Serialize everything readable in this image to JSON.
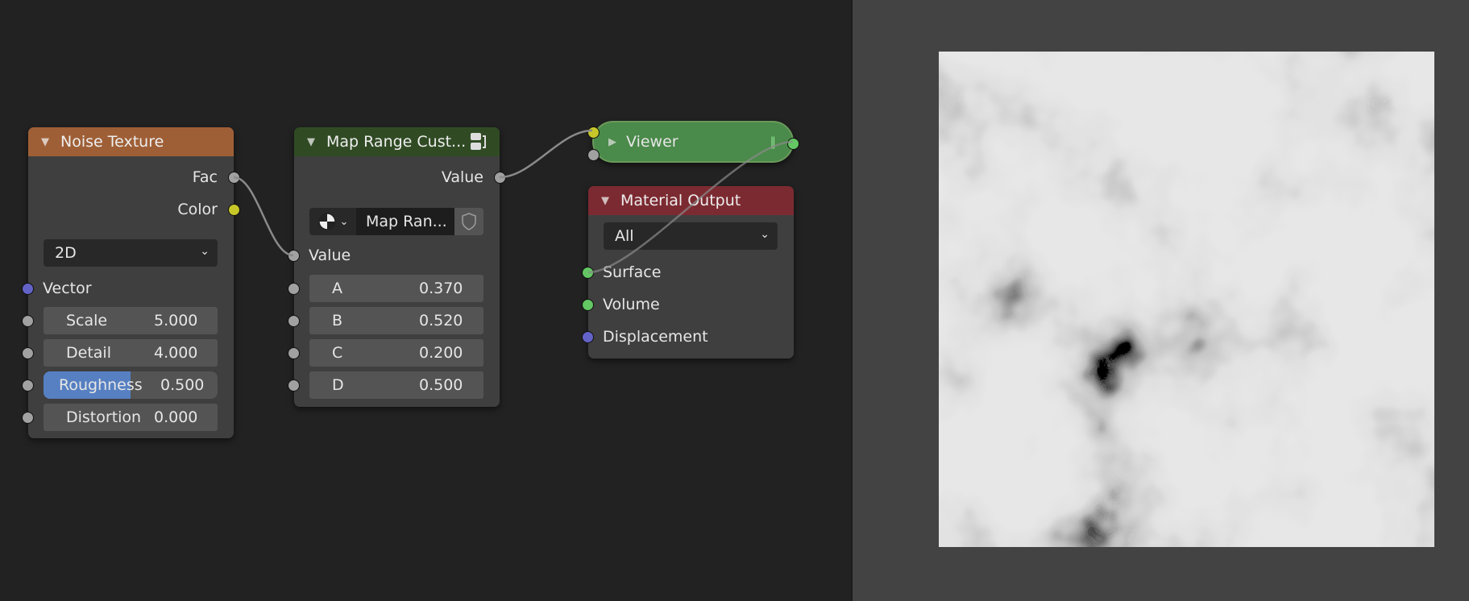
{
  "noise_texture": {
    "title": "Noise Texture",
    "header_color": "#9f5f36",
    "outputs": [
      "Fac",
      "Color"
    ],
    "dimensions": "2D",
    "vector_label": "Vector",
    "fields": [
      {
        "label": "Scale",
        "value": "5.000"
      },
      {
        "label": "Detail",
        "value": "4.000"
      },
      {
        "label": "Roughness",
        "value": "0.500",
        "fill": 0.5
      },
      {
        "label": "Distortion",
        "value": "0.000"
      }
    ]
  },
  "map_range": {
    "title": "Map Range Cust...",
    "header_color": "#304b24",
    "output": "Value",
    "group_name": "Map Ran...",
    "input_value": "Value",
    "fields": [
      {
        "label": "A",
        "value": "0.370"
      },
      {
        "label": "B",
        "value": "0.520"
      },
      {
        "label": "C",
        "value": "0.200"
      },
      {
        "label": "D",
        "value": "0.500"
      }
    ]
  },
  "viewer": {
    "title": "Viewer",
    "color": "#4a8a4a"
  },
  "material_output": {
    "title": "Material Output",
    "header_color": "#7c2a31",
    "target": "All",
    "inputs": [
      "Surface",
      "Volume",
      "Displacement"
    ]
  },
  "preview": {
    "type": "noise-texture-grayscale"
  }
}
